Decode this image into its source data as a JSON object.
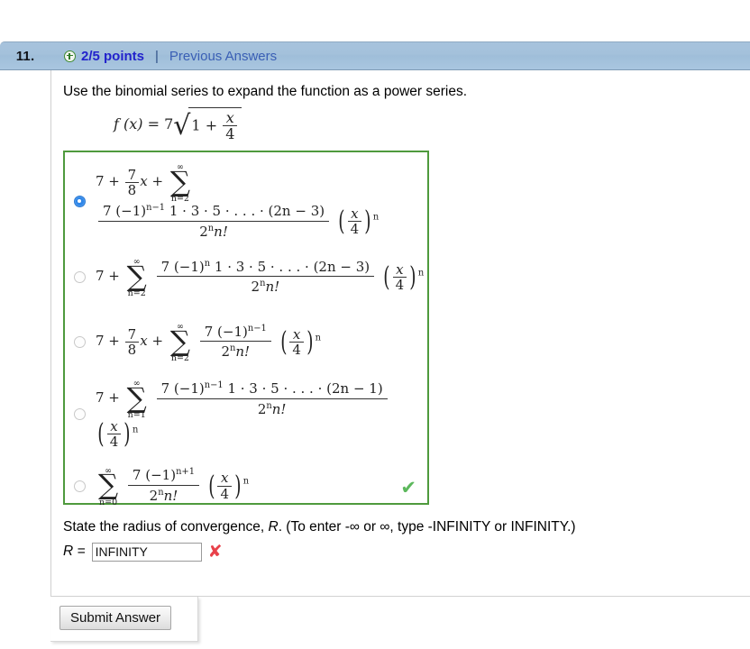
{
  "header": {
    "question_number": "11.",
    "points_icon": "plus-circle-icon",
    "points": "2/5 points",
    "separator": "|",
    "previous_answers": "Previous Answers",
    "bar_color": "#a4c1db",
    "points_color": "#2222cc",
    "link_color": "#3a5fb5"
  },
  "question": {
    "prompt": "Use the binomial series to expand the function as a power series.",
    "function": {
      "lhs": "f (x) =",
      "coefficient": "7",
      "radical": "√",
      "radicand_left": "1 +",
      "radicand_frac_num": "x",
      "radicand_frac_den": "4"
    }
  },
  "choices_box": {
    "border_color": "#4f9a3d",
    "correct_icon": "green-checkmark-icon",
    "correct_mark": "✔",
    "correct_color": "#5cb85c"
  },
  "choices": [
    {
      "id": "choice-1",
      "selected": true,
      "leading": "7 +",
      "lead_frac_num": "7",
      "lead_frac_den": "8",
      "lead_var": "x",
      "plus": "+",
      "sigma_top": "∞",
      "sigma_glyph": "∑",
      "sigma_bottom": "n=2",
      "numerator": "7 (−1)",
      "numerator_exp": "n−1",
      "numerator_tail": "1 · 3 · 5 · . . . · (2n − 3)",
      "denominator_base": "2",
      "denominator_exp": "n",
      "denominator_tail": "n!",
      "tail_num": "x",
      "tail_den": "4",
      "tail_exp": "n"
    },
    {
      "id": "choice-2",
      "selected": false,
      "leading": "7 +",
      "lead_frac_num": "",
      "lead_frac_den": "",
      "lead_var": "",
      "plus": "",
      "sigma_top": "∞",
      "sigma_glyph": "∑",
      "sigma_bottom": "n=2",
      "numerator": "7 (−1)",
      "numerator_exp": "n",
      "numerator_tail": "1 · 3 · 5 · . . . · (2n − 3)",
      "denominator_base": "2",
      "denominator_exp": "n",
      "denominator_tail": "n!",
      "tail_num": "x",
      "tail_den": "4",
      "tail_exp": "n"
    },
    {
      "id": "choice-3",
      "selected": false,
      "leading": "7 +",
      "lead_frac_num": "7",
      "lead_frac_den": "8",
      "lead_var": "x",
      "plus": "+",
      "sigma_top": "∞",
      "sigma_glyph": "∑",
      "sigma_bottom": "n=2",
      "numerator": "7 (−1)",
      "numerator_exp": "n−1",
      "numerator_tail": "",
      "denominator_base": "2",
      "denominator_exp": "n",
      "denominator_tail": "n!",
      "tail_num": "x",
      "tail_den": "4",
      "tail_exp": "n"
    },
    {
      "id": "choice-4",
      "selected": false,
      "leading": "7 +",
      "lead_frac_num": "",
      "lead_frac_den": "",
      "lead_var": "",
      "plus": "",
      "sigma_top": "∞",
      "sigma_glyph": "∑",
      "sigma_bottom": "n=1",
      "numerator": "7 (−1)",
      "numerator_exp": "n−1",
      "numerator_tail": "1 · 3 · 5 · . . . · (2n − 1)",
      "denominator_base": "2",
      "denominator_exp": "n",
      "denominator_tail": "n!",
      "tail_num": "x",
      "tail_den": "4",
      "tail_exp": "n"
    },
    {
      "id": "choice-5",
      "selected": false,
      "leading": "",
      "lead_frac_num": "",
      "lead_frac_den": "",
      "lead_var": "",
      "plus": "",
      "sigma_top": "∞",
      "sigma_glyph": "∑",
      "sigma_bottom": "n=0",
      "numerator": "7 (−1)",
      "numerator_exp": "n+1",
      "numerator_tail": "",
      "denominator_base": "2",
      "denominator_exp": "n",
      "denominator_tail": "n!",
      "tail_num": "x",
      "tail_den": "4",
      "tail_exp": "n"
    }
  ],
  "radius": {
    "instruction_part1": "State the radius of convergence, ",
    "instruction_var": "R",
    "instruction_part2": ". (To enter -∞ or ∞, type -INFINITY or INFINITY.)",
    "label": "R  =",
    "value": "INFINITY",
    "placeholder": "",
    "result_icon": "red-x-icon",
    "result_mark": "✘",
    "result_color": "#e8414a"
  },
  "footer": {
    "submit_label": "Submit Answer"
  }
}
